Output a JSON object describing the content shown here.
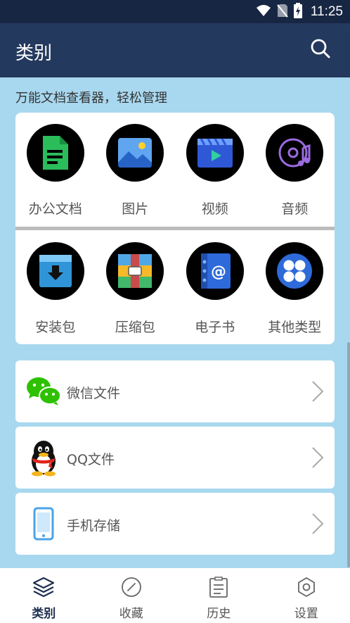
{
  "status_bar": {
    "time": "11:25",
    "icons": [
      "wifi-icon",
      "no-sim-icon",
      "battery-charging-icon"
    ]
  },
  "app_bar": {
    "title": "类别",
    "search_icon": "search-icon"
  },
  "subtitle": "万能文档查看器，轻松管理",
  "categories": [
    {
      "label": "办公文档",
      "icon": "document-icon"
    },
    {
      "label": "图片",
      "icon": "image-icon"
    },
    {
      "label": "视频",
      "icon": "video-icon"
    },
    {
      "label": "音频",
      "icon": "audio-icon"
    },
    {
      "label": "安装包",
      "icon": "package-icon"
    },
    {
      "label": "压缩包",
      "icon": "archive-icon"
    },
    {
      "label": "电子书",
      "icon": "ebook-icon"
    },
    {
      "label": "其他类型",
      "icon": "other-types-icon"
    }
  ],
  "sources": [
    {
      "label": "微信文件",
      "icon": "wechat-icon"
    },
    {
      "label": "QQ文件",
      "icon": "qq-icon"
    },
    {
      "label": "手机存储",
      "icon": "phone-storage-icon"
    }
  ],
  "bottom_nav": [
    {
      "label": "类别",
      "icon": "layers-icon",
      "active": true
    },
    {
      "label": "收藏",
      "icon": "compass-icon",
      "active": false
    },
    {
      "label": "历史",
      "icon": "history-icon",
      "active": false
    },
    {
      "label": "设置",
      "icon": "settings-icon",
      "active": false
    }
  ],
  "colors": {
    "status_bar": "#172643",
    "app_bar": "#24395e",
    "background": "#a8d8ef",
    "active_nav": "#1e2f50"
  }
}
